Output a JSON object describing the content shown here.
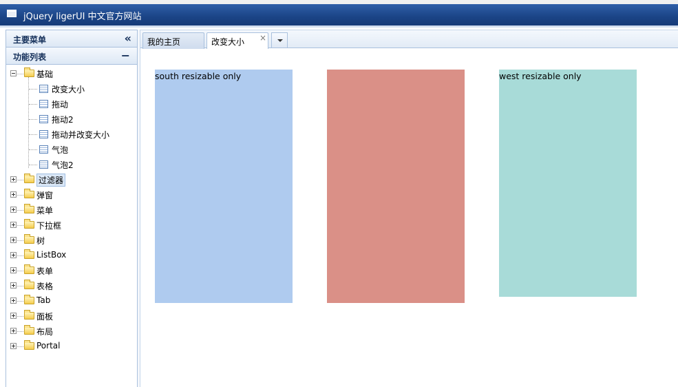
{
  "app": {
    "title": "jQuery ligerUI 中文官方网站",
    "header_color": "#1b4486"
  },
  "left_panel": {
    "main_menu_title": "主要菜单",
    "collapse_icon": "double-chevron-left-icon",
    "collapse_glyph": "«",
    "function_list_title": "功能列表",
    "minus_glyph": "−",
    "tree": [
      {
        "label": "基础",
        "expanded": true,
        "children": [
          "改变大小",
          "拖动",
          "拖动2",
          "拖动并改变大小",
          "气泡",
          "气泡2"
        ]
      },
      {
        "label": "过滤器",
        "expanded": false,
        "selected": true
      },
      {
        "label": "弹窗",
        "expanded": false
      },
      {
        "label": "菜单",
        "expanded": false
      },
      {
        "label": "下拉框",
        "expanded": false
      },
      {
        "label": "树",
        "expanded": false
      },
      {
        "label": "ListBox",
        "expanded": false
      },
      {
        "label": "表单",
        "expanded": false
      },
      {
        "label": "表格",
        "expanded": false
      },
      {
        "label": "Tab",
        "expanded": false
      },
      {
        "label": "面板",
        "expanded": false
      },
      {
        "label": "布局",
        "expanded": false
      },
      {
        "label": "Portal",
        "expanded": false
      }
    ]
  },
  "tabs": {
    "items": [
      {
        "label": "我的主页",
        "active": false
      },
      {
        "label": "改变大小",
        "active": true,
        "closable": true
      }
    ],
    "close_glyph": "×"
  },
  "content": {
    "boxes": [
      {
        "text": "south resizable only",
        "color": "#afcbef"
      },
      {
        "text": "",
        "color": "#da9087"
      },
      {
        "text": "west resizable only",
        "color": "#a8dbd8"
      }
    ]
  }
}
